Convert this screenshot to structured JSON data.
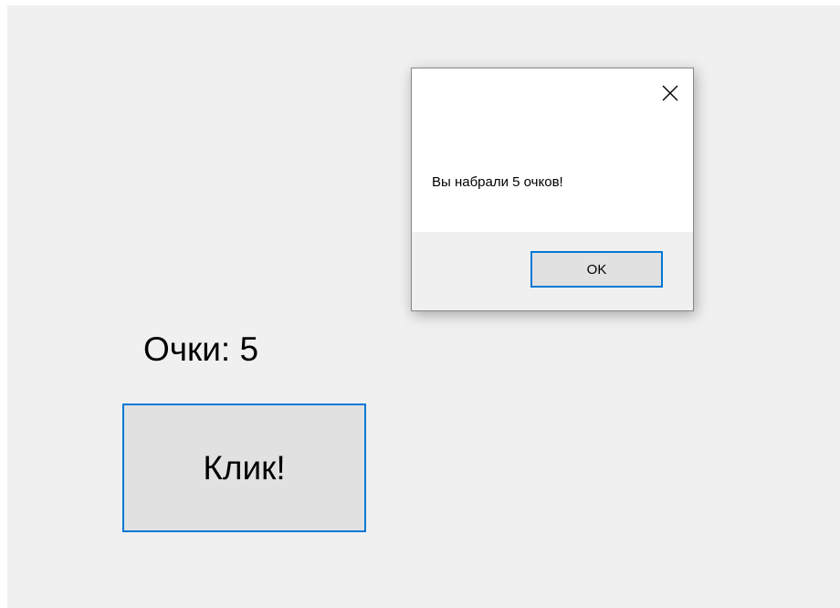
{
  "game": {
    "score_label": "Очки: 5",
    "click_button_label": "Клик!"
  },
  "dialog": {
    "message": "Вы набрали 5 очков!",
    "ok_label": "OK",
    "close_icon": "close-icon"
  },
  "colors": {
    "window_background": "#f0f0f0",
    "button_face": "#e1e1e1",
    "focus_border": "#0078d7",
    "dialog_background": "#ffffff"
  }
}
